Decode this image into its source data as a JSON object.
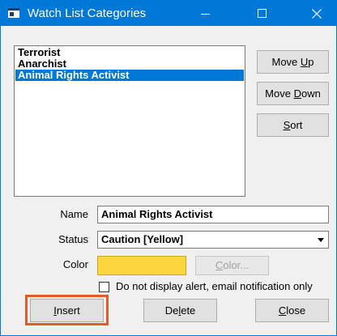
{
  "window": {
    "title": "Watch List Categories"
  },
  "titlebar_buttons": {
    "minimize_icon": "minimize-icon",
    "maximize_icon": "maximize-icon",
    "close_icon": "close-icon"
  },
  "categories": [
    {
      "label": "Terrorist",
      "selected": false
    },
    {
      "label": "Anarchist",
      "selected": false
    },
    {
      "label": "Animal Rights Activist",
      "selected": true
    }
  ],
  "side_buttons": {
    "move_up": {
      "pre": "Move ",
      "key": "U",
      "post": "p"
    },
    "move_down": {
      "pre": "Move ",
      "key": "D",
      "post": "own"
    },
    "sort": {
      "pre": "",
      "key": "S",
      "post": "ort"
    }
  },
  "form": {
    "name_label": "Name",
    "name_value": "Animal Rights Activist",
    "status_label": "Status",
    "status_value": "Caution [Yellow]",
    "color_label": "Color",
    "color_value": "#fcd63f",
    "color_button": {
      "pre": "",
      "key": "C",
      "post": "olor..."
    },
    "checkbox_label": "Do not display alert, email notification only",
    "checkbox_checked": false
  },
  "bottom_buttons": {
    "insert": {
      "pre": "",
      "key": "I",
      "post": "nsert"
    },
    "delete": {
      "pre": "De",
      "key": "l",
      "post": "ete"
    },
    "close": {
      "pre": "",
      "key": "C",
      "post": "lose"
    }
  },
  "colors": {
    "titlebar": "#0078d7",
    "selection": "#0078d7",
    "highlight_border": "#e35a2f",
    "swatch": "#fcd63f"
  }
}
